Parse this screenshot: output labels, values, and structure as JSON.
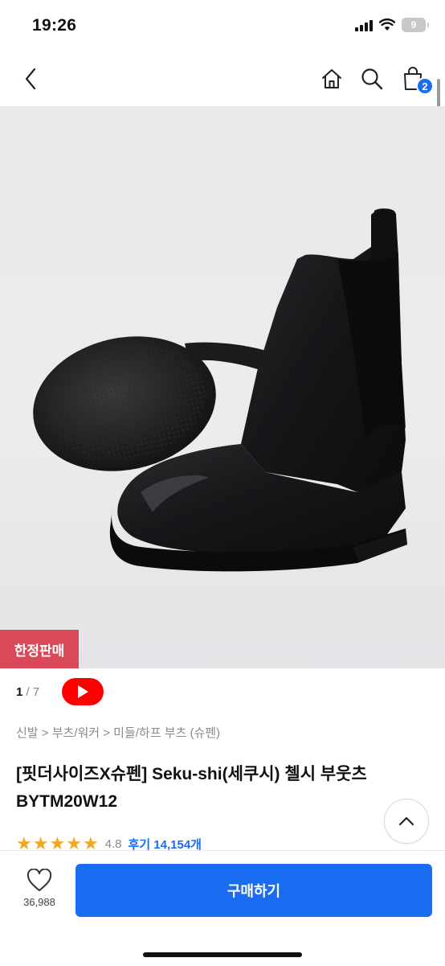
{
  "status_bar": {
    "time": "19:26",
    "battery": "9"
  },
  "nav": {
    "cart_count": "2"
  },
  "badge": {
    "limited": "한정판매"
  },
  "gallery": {
    "current": "1",
    "separator": " / ",
    "total": "7"
  },
  "breadcrumb": "신발 > 부츠/워커 > 미들/하프 부츠 (슈펜)",
  "product": {
    "title": "[핏더사이즈X슈펜] Seku-shi(세쿠시) 첼시 부웃츠 BYTM20W12",
    "rating": "4.8",
    "stars": 5,
    "reviews": "후기 14,154개"
  },
  "bottom_bar": {
    "like_count": "36,988",
    "buy_label": "구매하기"
  },
  "colors": {
    "accent": "#1a6cf0",
    "badge": "#d9495a",
    "star": "#f4a521",
    "youtube": "#ff0000"
  },
  "icons": [
    "back-arrow-icon",
    "home-icon",
    "search-icon",
    "shopping-bag-icon",
    "youtube-play-icon",
    "chevron-up-icon",
    "heart-icon",
    "star-icon"
  ]
}
